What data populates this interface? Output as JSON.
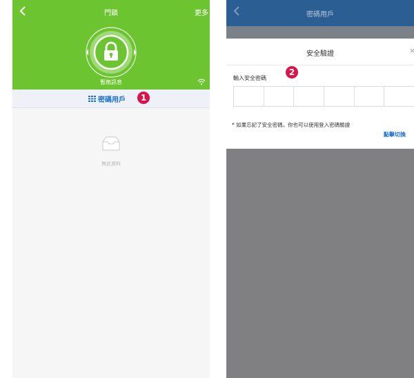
{
  "left_screen": {
    "title": "門鎖",
    "more_label": "更多",
    "status_text": "暫無訊息",
    "tab_label": "密碼用戶",
    "empty_text": "無此資料",
    "step_badge": "1",
    "icons": [
      "back-arrow-icon",
      "lock-icon",
      "wifi-icon",
      "grid-icon",
      "empty-tray-icon"
    ],
    "colors": {
      "header": "#6cc530",
      "accent": "#1a6fd1",
      "badge": "#d8144a"
    }
  },
  "right_screen": {
    "title": "密碼用戶",
    "dialog": {
      "title": "安全驗證",
      "close_symbol": "×",
      "password_label": "輸入安全密碼",
      "code_cells": 6,
      "hint": "* 如果忘記了安全密碼，你也可以使用登入密碼驗證",
      "switch_link": "點擊切換"
    },
    "step_badge": "2",
    "icons": [
      "back-arrow-icon",
      "close-icon"
    ],
    "colors": {
      "header": "#2b5f94",
      "overlay": "#808083",
      "accent": "#1a6fd1"
    }
  }
}
